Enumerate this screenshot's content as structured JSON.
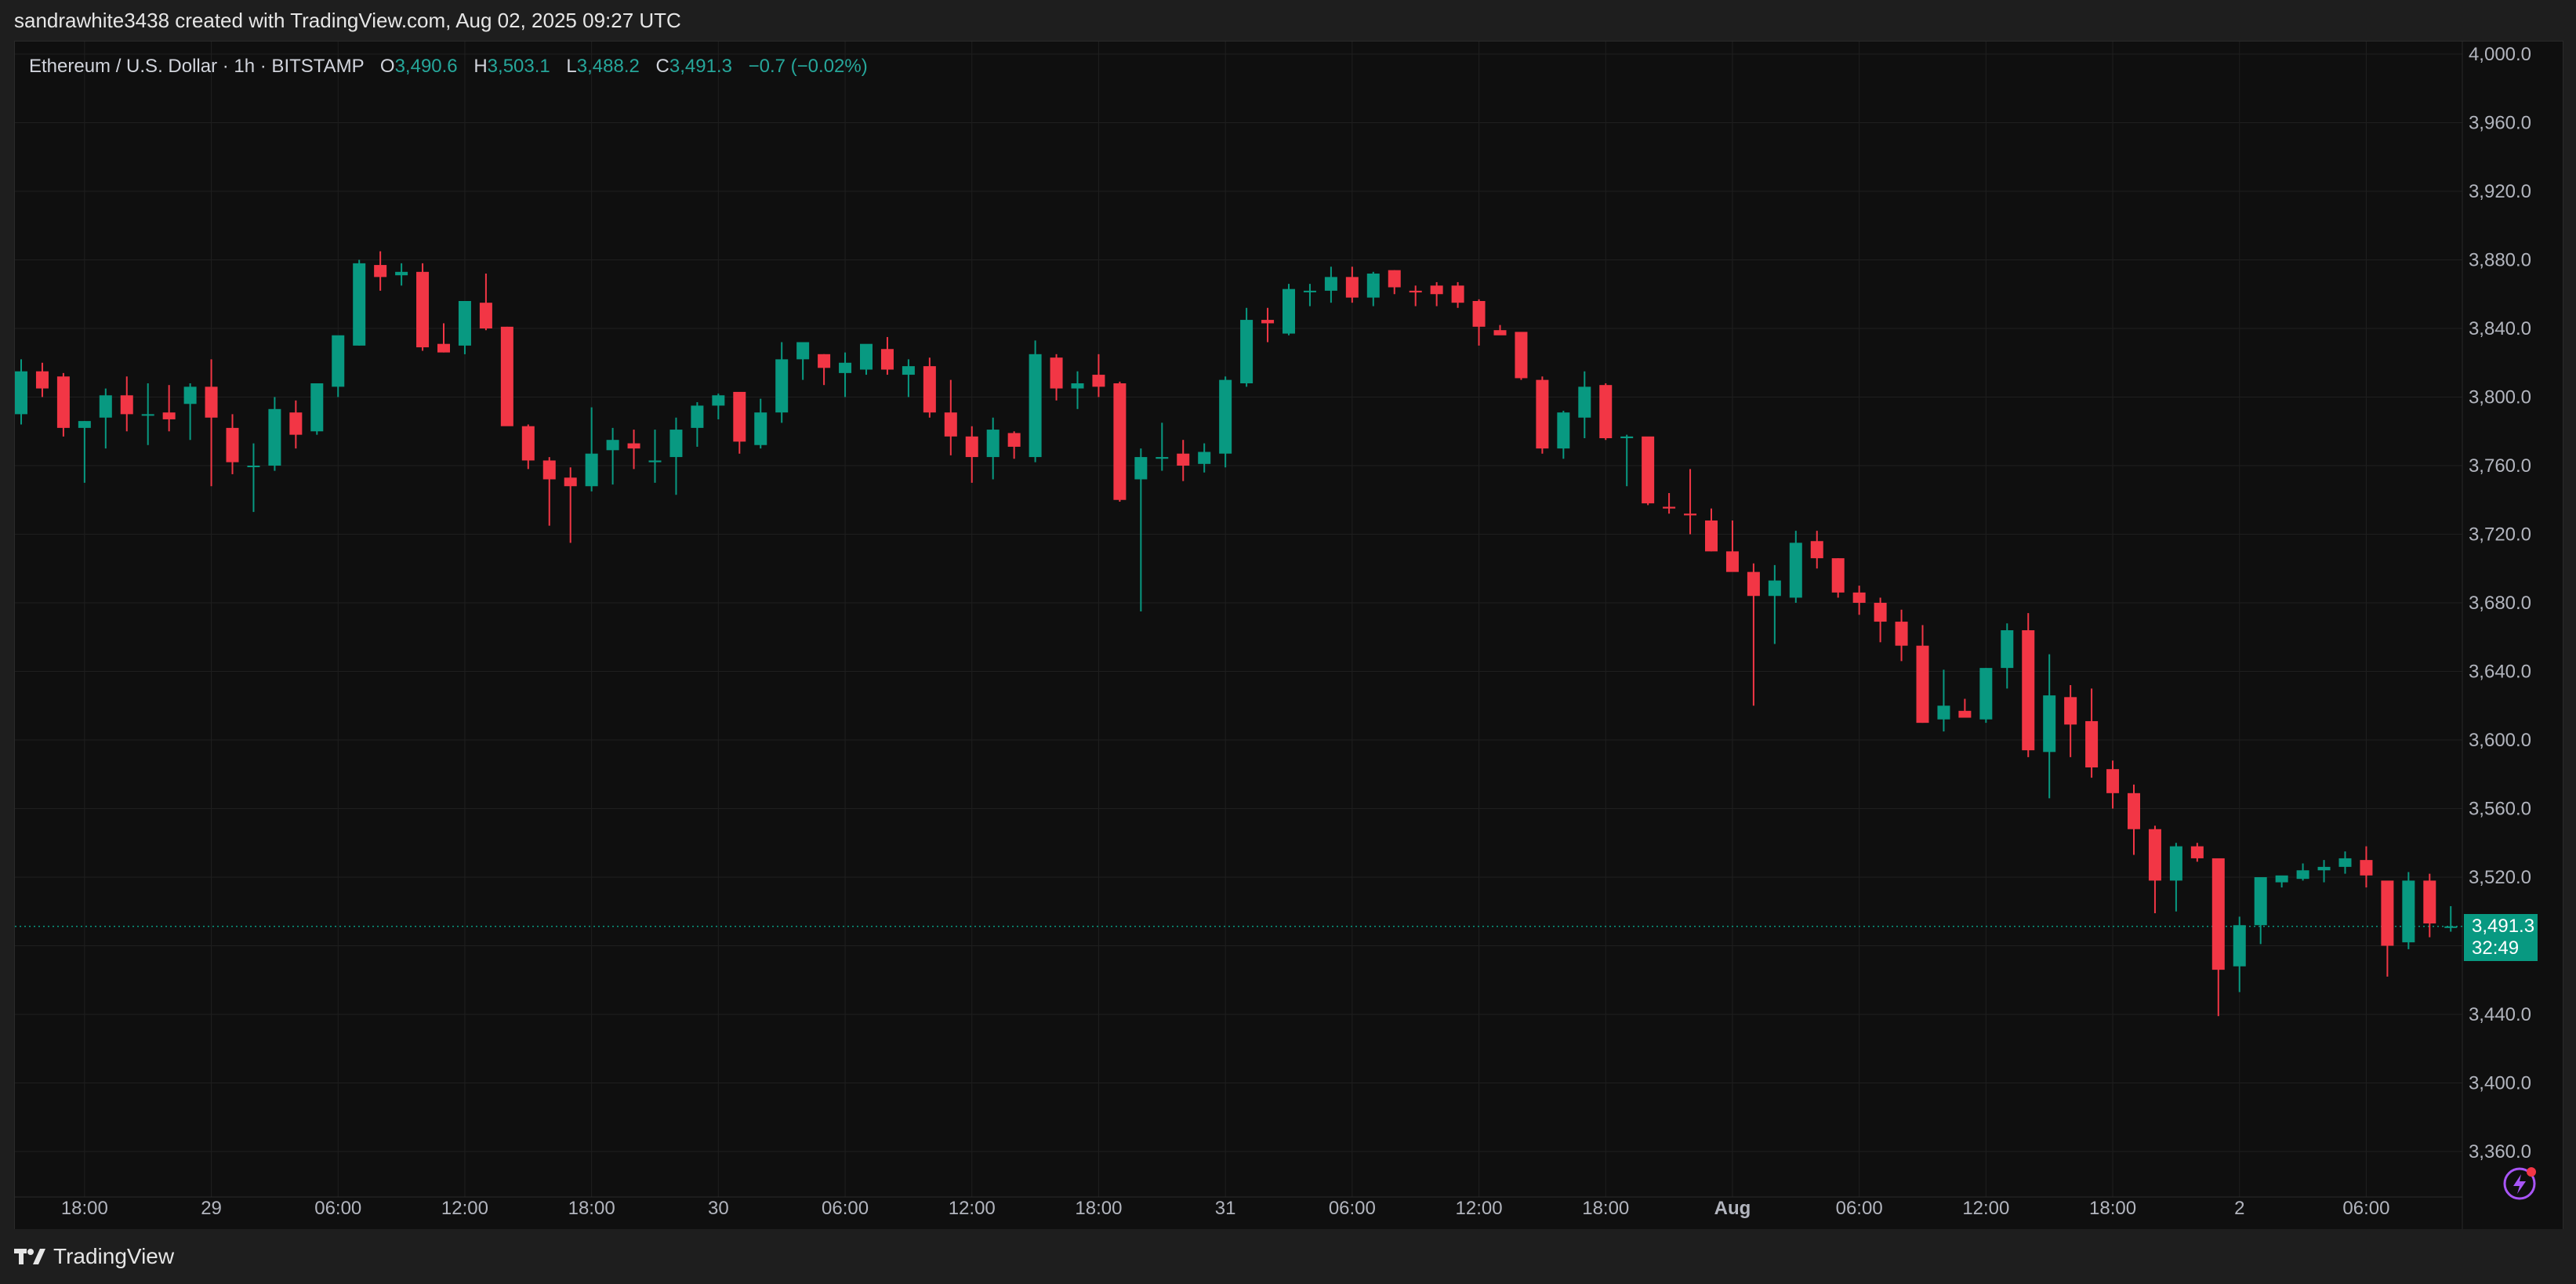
{
  "header": {
    "attribution": "sandrawhite3438 created with TradingView.com, Aug 02, 2025 09:27 UTC"
  },
  "legend": {
    "symbol": "Ethereum / U.S. Dollar · 1h · BITSTAMP",
    "open_label": "O",
    "open": "3,490.6",
    "high_label": "H",
    "high": "3,503.1",
    "low_label": "L",
    "low": "3,488.2",
    "close_label": "C",
    "close": "3,491.3",
    "change": "−0.7 (−0.02%)"
  },
  "price_tag": {
    "price": "3,491.3",
    "countdown": "32:49"
  },
  "footer": {
    "brand": "TradingView"
  },
  "colors": {
    "up": "#089981",
    "down": "#f23645",
    "background": "#0f0f0f",
    "grid": "#1f1f1f",
    "axis_text": "#b2b5be",
    "accent": "#a855f7"
  },
  "chart_data": {
    "type": "candlestick",
    "title": "Ethereum / U.S. Dollar · 1h · BITSTAMP",
    "ylim": [
      3340,
      4000
    ],
    "y_ticks": [
      "4,000.0",
      "3,960.0",
      "3,920.0",
      "3,880.0",
      "3,840.0",
      "3,800.0",
      "3,760.0",
      "3,720.0",
      "3,680.0",
      "3,640.0",
      "3,600.0",
      "3,560.0",
      "3,520.0",
      "3,480.0",
      "3,440.0",
      "3,400.0",
      "3,360.0"
    ],
    "y_tick_values": [
      4000,
      3960,
      3920,
      3880,
      3840,
      3800,
      3760,
      3720,
      3680,
      3640,
      3600,
      3560,
      3520,
      3480,
      3440,
      3400,
      3360
    ],
    "x_ticks": [
      {
        "label": "18:00",
        "bar": 3
      },
      {
        "label": "29",
        "bar": 9
      },
      {
        "label": "06:00",
        "bar": 15
      },
      {
        "label": "12:00",
        "bar": 21
      },
      {
        "label": "18:00",
        "bar": 27
      },
      {
        "label": "30",
        "bar": 33
      },
      {
        "label": "06:00",
        "bar": 39
      },
      {
        "label": "12:00",
        "bar": 45
      },
      {
        "label": "18:00",
        "bar": 51
      },
      {
        "label": "31",
        "bar": 57
      },
      {
        "label": "06:00",
        "bar": 63
      },
      {
        "label": "12:00",
        "bar": 69
      },
      {
        "label": "18:00",
        "bar": 75
      },
      {
        "label": "Aug",
        "bar": 81
      },
      {
        "label": "06:00",
        "bar": 87
      },
      {
        "label": "12:00",
        "bar": 93
      },
      {
        "label": "18:00",
        "bar": 99
      },
      {
        "label": "2",
        "bar": 105
      },
      {
        "label": "06:00",
        "bar": 111
      }
    ],
    "last_price": 3491.3,
    "candles": [
      [
        3790,
        3822,
        3784,
        3815
      ],
      [
        3815,
        3820,
        3800,
        3805
      ],
      [
        3812,
        3814,
        3777,
        3782
      ],
      [
        3782,
        3786,
        3750,
        3786
      ],
      [
        3788,
        3805,
        3770,
        3801
      ],
      [
        3801,
        3812,
        3780,
        3790
      ],
      [
        3790,
        3808,
        3772,
        3790
      ],
      [
        3791,
        3807,
        3780,
        3787
      ],
      [
        3796,
        3808,
        3775,
        3806
      ],
      [
        3806,
        3822,
        3748,
        3788
      ],
      [
        3782,
        3790,
        3755,
        3762
      ],
      [
        3760,
        3773,
        3733,
        3760
      ],
      [
        3760,
        3800,
        3757,
        3793
      ],
      [
        3791,
        3798,
        3770,
        3778
      ],
      [
        3780,
        3808,
        3778,
        3808
      ],
      [
        3806,
        3835,
        3800,
        3836
      ],
      [
        3830,
        3880,
        3830,
        3878
      ],
      [
        3877,
        3885,
        3862,
        3870
      ],
      [
        3871,
        3878,
        3865,
        3873
      ],
      [
        3873,
        3878,
        3827,
        3829
      ],
      [
        3831,
        3843,
        3826,
        3826
      ],
      [
        3830,
        3855,
        3825,
        3856
      ],
      [
        3855,
        3872,
        3839,
        3840
      ],
      [
        3841,
        3841,
        3795,
        3783
      ],
      [
        3783,
        3784,
        3758,
        3763
      ],
      [
        3763,
        3765,
        3725,
        3752
      ],
      [
        3753,
        3759,
        3715,
        3748
      ],
      [
        3748,
        3794,
        3745,
        3767
      ],
      [
        3769,
        3782,
        3749,
        3775
      ],
      [
        3773,
        3781,
        3758,
        3770
      ],
      [
        3762,
        3781,
        3750,
        3763
      ],
      [
        3765,
        3788,
        3743,
        3781
      ],
      [
        3782,
        3797,
        3771,
        3795
      ],
      [
        3795,
        3802,
        3787,
        3801
      ],
      [
        3803,
        3800,
        3767,
        3774
      ],
      [
        3772,
        3799,
        3770,
        3791
      ],
      [
        3791,
        3832,
        3785,
        3822
      ],
      [
        3822,
        3830,
        3810,
        3832
      ],
      [
        3825,
        3825,
        3807,
        3817
      ],
      [
        3814,
        3826,
        3800,
        3820
      ],
      [
        3816,
        3830,
        3813,
        3831
      ],
      [
        3828,
        3835,
        3813,
        3816
      ],
      [
        3813,
        3822,
        3800,
        3818
      ],
      [
        3818,
        3823,
        3788,
        3791
      ],
      [
        3791,
        3810,
        3766,
        3777
      ],
      [
        3777,
        3783,
        3750,
        3765
      ],
      [
        3765,
        3788,
        3752,
        3781
      ],
      [
        3779,
        3780,
        3764,
        3771
      ],
      [
        3765,
        3833,
        3762,
        3825
      ],
      [
        3823,
        3825,
        3798,
        3805
      ],
      [
        3805,
        3815,
        3793,
        3808
      ],
      [
        3813,
        3825,
        3800,
        3806
      ],
      [
        3808,
        3809,
        3739,
        3740
      ],
      [
        3752,
        3770,
        3675,
        3765
      ],
      [
        3764,
        3785,
        3757,
        3765
      ],
      [
        3767,
        3775,
        3751,
        3760
      ],
      [
        3761,
        3773,
        3756,
        3768
      ],
      [
        3767,
        3812,
        3759,
        3810
      ],
      [
        3808,
        3852,
        3806,
        3845
      ],
      [
        3845,
        3852,
        3832,
        3843
      ],
      [
        3837,
        3866,
        3836,
        3863
      ],
      [
        3862,
        3866,
        3853,
        3862
      ],
      [
        3862,
        3876,
        3855,
        3870
      ],
      [
        3870,
        3876,
        3855,
        3858
      ],
      [
        3858,
        3873,
        3853,
        3872
      ],
      [
        3874,
        3874,
        3860,
        3864
      ],
      [
        3862,
        3865,
        3853,
        3861
      ],
      [
        3865,
        3867,
        3853,
        3860
      ],
      [
        3865,
        3867,
        3852,
        3855
      ],
      [
        3856,
        3857,
        3830,
        3841
      ],
      [
        3839,
        3842,
        3837,
        3836
      ],
      [
        3838,
        3836,
        3810,
        3811
      ],
      [
        3810,
        3812,
        3767,
        3770
      ],
      [
        3770,
        3792,
        3764,
        3791
      ],
      [
        3788,
        3815,
        3776,
        3806
      ],
      [
        3807,
        3808,
        3775,
        3776
      ],
      [
        3776,
        3778,
        3748,
        3777
      ],
      [
        3777,
        3773,
        3737,
        3738
      ],
      [
        3736,
        3744,
        3732,
        3735
      ],
      [
        3732,
        3758,
        3720,
        3731
      ],
      [
        3728,
        3735,
        3710,
        3710
      ],
      [
        3710,
        3728,
        3700,
        3698
      ],
      [
        3698,
        3703,
        3620,
        3684
      ],
      [
        3684,
        3702,
        3656,
        3693
      ],
      [
        3683,
        3722,
        3680,
        3715
      ],
      [
        3716,
        3722,
        3700,
        3706
      ],
      [
        3706,
        3706,
        3683,
        3686
      ],
      [
        3686,
        3690,
        3673,
        3680
      ],
      [
        3680,
        3683,
        3657,
        3669
      ],
      [
        3669,
        3676,
        3646,
        3655
      ],
      [
        3655,
        3667,
        3610,
        3610
      ],
      [
        3612,
        3641,
        3605,
        3620
      ],
      [
        3617,
        3624,
        3614,
        3613
      ],
      [
        3612,
        3642,
        3610,
        3642
      ],
      [
        3642,
        3668,
        3630,
        3664
      ],
      [
        3664,
        3674,
        3590,
        3594
      ],
      [
        3593,
        3650,
        3566,
        3626
      ],
      [
        3625,
        3632,
        3590,
        3609
      ],
      [
        3611,
        3630,
        3578,
        3584
      ],
      [
        3583,
        3588,
        3560,
        3569
      ],
      [
        3569,
        3574,
        3533,
        3548
      ],
      [
        3548,
        3550,
        3499,
        3518
      ],
      [
        3518,
        3540,
        3500,
        3538
      ],
      [
        3538,
        3540,
        3529,
        3531
      ],
      [
        3531,
        3530,
        3439,
        3466
      ],
      [
        3468,
        3497,
        3453,
        3492
      ],
      [
        3492,
        3518,
        3481,
        3520
      ],
      [
        3517,
        3520,
        3514,
        3521
      ],
      [
        3519,
        3528,
        3518,
        3524
      ],
      [
        3524,
        3530,
        3517,
        3526
      ],
      [
        3526,
        3535,
        3522,
        3531
      ],
      [
        3530,
        3538,
        3514,
        3521
      ],
      [
        3518,
        3500,
        3462,
        3480
      ],
      [
        3482,
        3523,
        3478,
        3518
      ],
      [
        3518,
        3522,
        3485,
        3493
      ],
      [
        3490.6,
        3503.1,
        3488.2,
        3491.3
      ]
    ]
  }
}
